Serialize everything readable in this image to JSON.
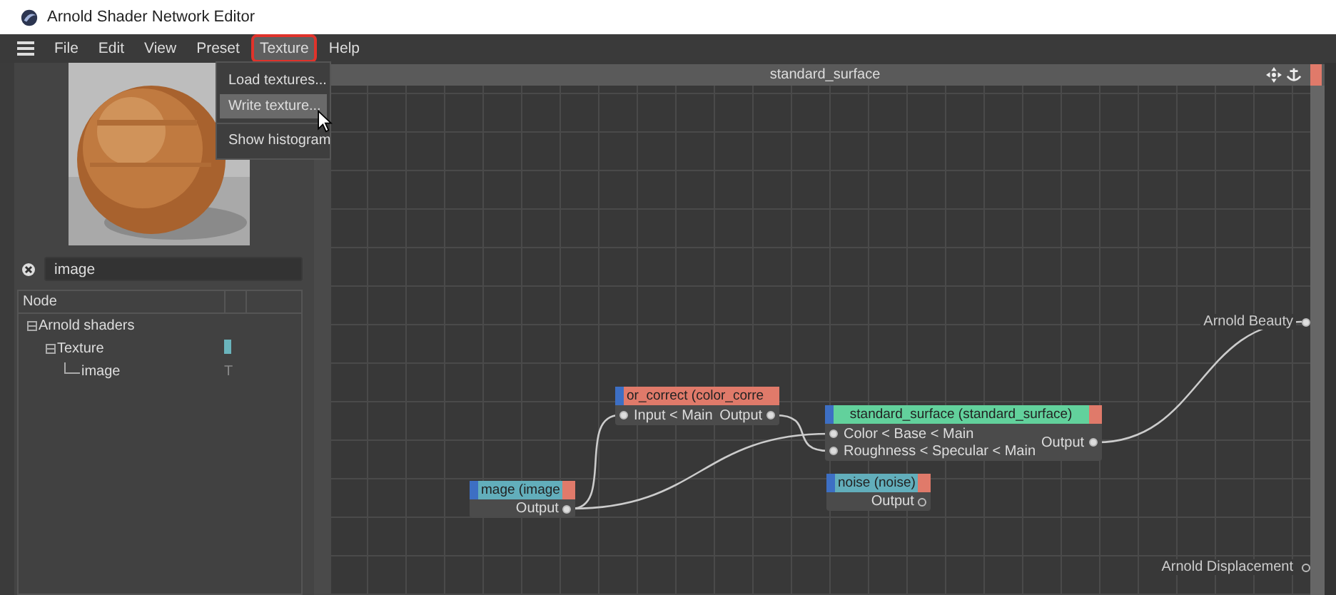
{
  "window": {
    "title": "Arnold Shader Network Editor"
  },
  "menu": [
    {
      "label": "File",
      "selected": false
    },
    {
      "label": "Edit",
      "selected": false
    },
    {
      "label": "View",
      "selected": false
    },
    {
      "label": "Preset",
      "selected": false
    },
    {
      "label": "Texture",
      "selected": true
    },
    {
      "label": "Help",
      "selected": false
    }
  ],
  "texture_menu": {
    "items": [
      {
        "label": "Load textures...",
        "selected": false,
        "separator_before": false
      },
      {
        "label": "Write texture...",
        "selected": true,
        "separator_before": false
      },
      {
        "label": "Show histogram",
        "selected": false,
        "separator_before": true
      }
    ]
  },
  "search": {
    "value": "image"
  },
  "tree": {
    "columns": [
      "Node"
    ],
    "items": [
      {
        "label": "Arnold shaders",
        "expanded": true,
        "children": [
          {
            "label": "Texture",
            "expanded": true,
            "color": "#6ab4bc",
            "children": [
              {
                "label": "image",
                "column_2": "T"
              }
            ]
          }
        ]
      }
    ]
  },
  "canvas": {
    "title": "standard_surface",
    "nodes": [
      {
        "title": "or_correct (color_corre",
        "color": "#e07a6a",
        "inputs": [
          {
            "label": "Input < Main",
            "connected": true
          }
        ],
        "output": {
          "label": "Output",
          "connected": true
        }
      },
      {
        "title": "standard_surface (standard_surface)",
        "color": "#62d19c",
        "inputs": [
          {
            "label": "Color < Base < Main",
            "connected": true
          },
          {
            "label": "Roughness < Specular < Main",
            "connected": true
          }
        ],
        "output": {
          "label": "Output",
          "connected": true
        }
      },
      {
        "title": "mage (image",
        "color": "#62aebb",
        "output": {
          "label": "Output",
          "connected": true
        }
      },
      {
        "title": "noise (noise)",
        "color": "#62aebb",
        "output": {
          "label": "Output",
          "connected": false
        }
      }
    ],
    "outputs": [
      {
        "label": "Arnold Beauty",
        "connected": true
      },
      {
        "label": "Arnold Displacement",
        "connected": false
      }
    ]
  }
}
